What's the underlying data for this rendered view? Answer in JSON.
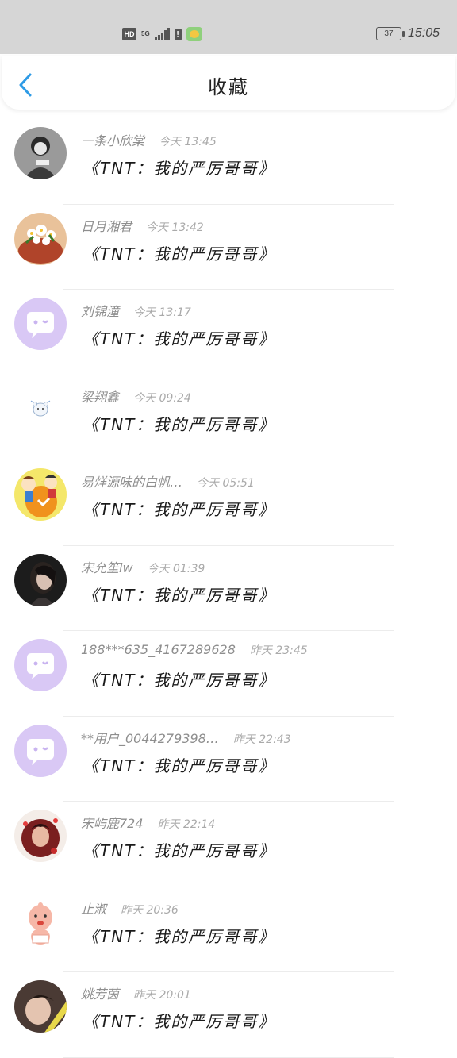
{
  "status_bar": {
    "hd_label": "HD",
    "network_label": "5G",
    "battery_level": "37",
    "time": "15:05",
    "icons": [
      "hd-icon",
      "signal-icon",
      "sim-alert-icon",
      "app-notification-icon",
      "battery-icon"
    ]
  },
  "header": {
    "back_icon": "chevron-left-icon",
    "title": "收藏",
    "accent_color": "#2e9be6"
  },
  "favorites": [
    {
      "user": "一条小欣棠",
      "time": "今天 13:45",
      "title": "《TNT：我的严厉哥哥》",
      "avatar": "photo-grayscale"
    },
    {
      "user": "日月湘君",
      "time": "今天 13:42",
      "title": "《TNT：我的严厉哥哥》",
      "avatar": "photo-flowers"
    },
    {
      "user": "刘锦潼",
      "time": "今天 13:17",
      "title": "《TNT：我的严厉哥哥》",
      "avatar": "default-chat"
    },
    {
      "user": "梁翔鑫",
      "time": "今天 09:24",
      "title": "《TNT：我的严厉哥哥》",
      "avatar": "sticker-bear"
    },
    {
      "user": "易烊源味的白帆…",
      "time": "今天 05:51",
      "title": "《TNT：我的严厉哥哥》",
      "avatar": "cartoon-orange"
    },
    {
      "user": "宋允笙lw",
      "time": "今天 01:39",
      "title": "《TNT：我的严厉哥哥》",
      "avatar": "photo-girl"
    },
    {
      "user": "188***635_4167289628",
      "time": "昨天 23:45",
      "title": "《TNT：我的严厉哥哥》",
      "avatar": "default-chat"
    },
    {
      "user": "**用户_0044279398…",
      "time": "昨天 22:43",
      "title": "《TNT：我的严厉哥哥》",
      "avatar": "default-chat"
    },
    {
      "user": "宋屿鹿724",
      "time": "昨天 22:14",
      "title": "《TNT：我的严厉哥哥》",
      "avatar": "photo-red"
    },
    {
      "user": "止淑",
      "time": "昨天 20:36",
      "title": "《TNT：我的严厉哥哥》",
      "avatar": "cartoon-baby"
    },
    {
      "user": "姚芳茵",
      "time": "昨天 20:01",
      "title": "《TNT：我的严厉哥哥》",
      "avatar": "photo-partial"
    }
  ]
}
